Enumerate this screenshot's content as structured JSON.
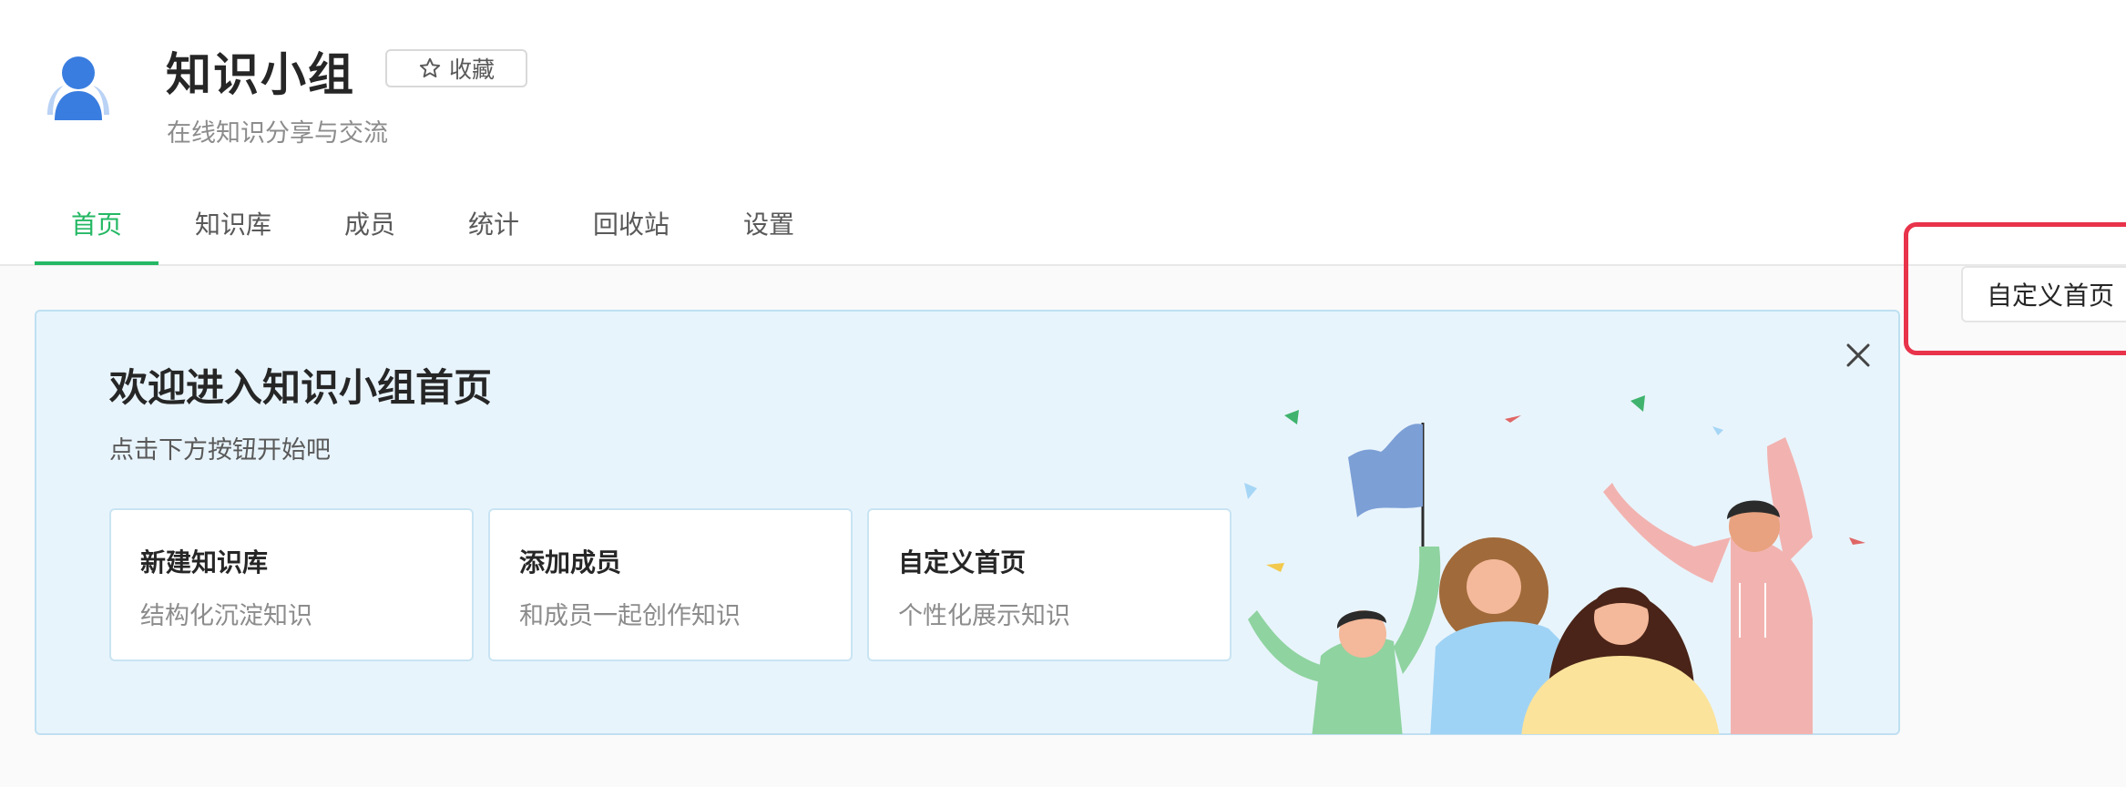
{
  "group": {
    "title": "知识小组",
    "favorite_label": "收藏",
    "description": "在线知识分享与交流"
  },
  "tabs": [
    {
      "label": "首页",
      "active": true
    },
    {
      "label": "知识库",
      "active": false
    },
    {
      "label": "成员",
      "active": false
    },
    {
      "label": "统计",
      "active": false
    },
    {
      "label": "回收站",
      "active": false
    },
    {
      "label": "设置",
      "active": false
    }
  ],
  "custom_home_button": "自定义首页",
  "banner": {
    "title": "欢迎进入知识小组首页",
    "subtitle": "点击下方按钮开始吧",
    "cards": [
      {
        "title": "新建知识库",
        "desc": "结构化沉淀知识"
      },
      {
        "title": "添加成员",
        "desc": "和成员一起创作知识"
      },
      {
        "title": "自定义首页",
        "desc": "个性化展示知识"
      }
    ]
  },
  "colors": {
    "accent": "#25b864",
    "banner_bg": "#e8f4fc",
    "highlight": "#e8334a"
  },
  "icons": [
    "group-avatar-icon",
    "star-icon",
    "close-icon"
  ]
}
